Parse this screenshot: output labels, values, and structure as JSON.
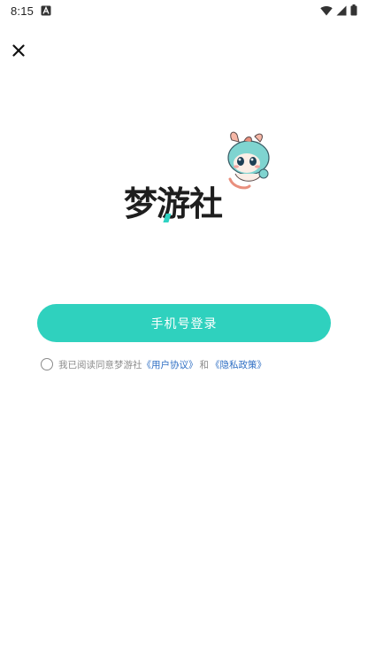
{
  "status_bar": {
    "time": "8:15",
    "notification_icon": "a-letter-icon",
    "wifi_icon": "wifi-icon",
    "signal_icon": "signal-icon",
    "battery_icon": "battery-icon"
  },
  "close_icon": "close-icon",
  "logo": {
    "text": "梦游社",
    "mascot_icon": "mascot-icon"
  },
  "login_button": {
    "label": "手机号登录",
    "color": "#2fd1be"
  },
  "agreement": {
    "prefix": "我已阅读同意梦游社",
    "user_agreement": "《用户协议》",
    "and": "和",
    "privacy_policy": "《隐私政策》",
    "link_color": "#2f6fc4"
  }
}
